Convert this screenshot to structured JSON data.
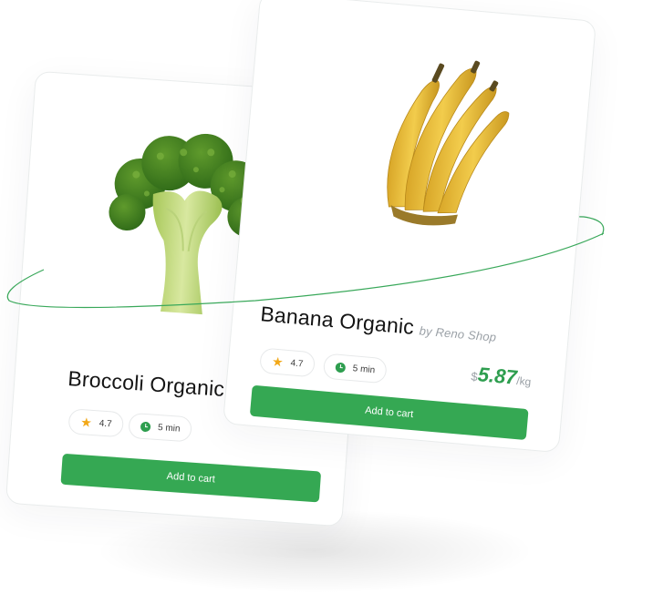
{
  "theme": {
    "accent": "#35a853",
    "price_color": "#2e9e4f",
    "star_color": "#f2a818"
  },
  "broccoli_card": {
    "title": "Broccoli Organic",
    "rating": "4.7",
    "time": "5 min",
    "button_label": "Add to cart",
    "image_icon": "broccoli-image"
  },
  "banana_card": {
    "title": "Banana Organic",
    "shop": "by Reno Shop",
    "rating": "4.7",
    "time": "5 min",
    "currency": "$",
    "price": "5.87",
    "unit": "/kg",
    "button_label": "Add to cart",
    "image_icon": "banana-image"
  }
}
